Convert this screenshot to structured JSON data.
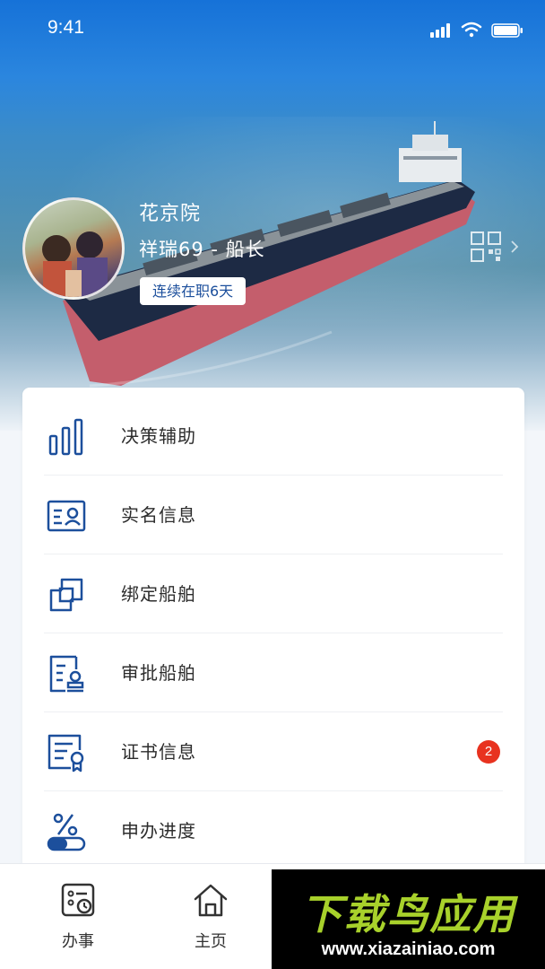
{
  "status_bar": {
    "time": "9:41"
  },
  "profile": {
    "name": "花京院",
    "role": "祥瑞69 - 船长",
    "tenure": "连续在职6天"
  },
  "menu": {
    "items": [
      {
        "label": "决策辅助",
        "icon": "bar-chart-icon"
      },
      {
        "label": "实名信息",
        "icon": "id-card-icon"
      },
      {
        "label": "绑定船舶",
        "icon": "link-squares-icon"
      },
      {
        "label": "审批船舶",
        "icon": "approval-stamp-icon"
      },
      {
        "label": "证书信息",
        "icon": "certificate-icon",
        "badge": "2"
      },
      {
        "label": "申办进度",
        "icon": "progress-percent-icon"
      }
    ]
  },
  "tab_bar": {
    "items": [
      {
        "label": "办事",
        "icon": "clipboard-clock-icon"
      },
      {
        "label": "主页",
        "icon": "home-icon"
      }
    ]
  },
  "watermark": {
    "title": "下载鸟应用",
    "url": "www.xiazainiao.com"
  },
  "colors": {
    "icon_blue": "#1c4f9c",
    "badge_red": "#e8321f",
    "watermark_green": "#a8d12b"
  }
}
